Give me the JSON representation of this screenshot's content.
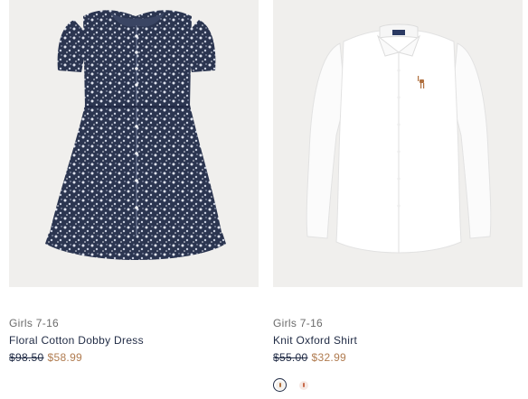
{
  "products": [
    {
      "category": "Girls 7-16",
      "name": "Floral Cotton Dobby Dress",
      "original_price": "$98.50",
      "sale_price": "$58.99",
      "image": "floral-dress-image"
    },
    {
      "category": "Girls 7-16",
      "name": "Knit Oxford Shirt",
      "original_price": "$55.00",
      "sale_price": "$32.99",
      "image": "white-oxford-shirt-image",
      "swatches": [
        "white-swatch",
        "pink-swatch"
      ]
    }
  ],
  "colors": {
    "text": "#1f2a44",
    "muted": "#6b6b6b",
    "sale": "#b07b4f",
    "image_bg": "#f0efed"
  }
}
